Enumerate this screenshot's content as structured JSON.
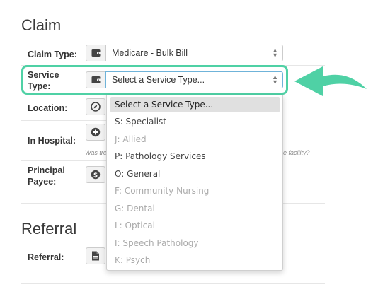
{
  "claim": {
    "title": "Claim",
    "claim_type_label": "Claim Type:",
    "claim_type_value": "Medicare - Bulk Bill",
    "service_type_label_1": "Service",
    "service_type_label_2": "Type:",
    "service_type_placeholder": "Select a Service Type...",
    "location_label": "Location:",
    "in_hospital_label": "In Hospital:",
    "in_hospital_hint_left": "Was tre",
    "in_hospital_hint_right": "e facility?",
    "principal_payee_label_1": "Principal",
    "principal_payee_label_2": "Payee:"
  },
  "referral": {
    "title": "Referral",
    "referral_label": "Referral:"
  },
  "service_type_options": [
    {
      "label": "Select a Service Type...",
      "state": "selected"
    },
    {
      "label": "S: Specialist",
      "state": "enabled"
    },
    {
      "label": "J: Allied",
      "state": "disabled"
    },
    {
      "label": "P: Pathology Services",
      "state": "enabled"
    },
    {
      "label": "O: General",
      "state": "enabled"
    },
    {
      "label": "F: Community Nursing",
      "state": "disabled"
    },
    {
      "label": "G: Dental",
      "state": "disabled"
    },
    {
      "label": "L: Optical",
      "state": "disabled"
    },
    {
      "label": "I: Speech Pathology",
      "state": "disabled"
    },
    {
      "label": "K: Psych",
      "state": "disabled"
    }
  ],
  "icons": {
    "claim_type": "wallet-icon",
    "service_type": "wallet-icon",
    "location": "compass-icon",
    "in_hospital": "plus-circle-icon",
    "principal_payee": "dollar-circle-icon",
    "referral": "document-icon",
    "pointer": "arrow-left-icon"
  },
  "colors": {
    "highlight": "#4fd1a5",
    "selected_option_bg": "#e0e0e0",
    "disabled_text": "#aaaaaa"
  }
}
